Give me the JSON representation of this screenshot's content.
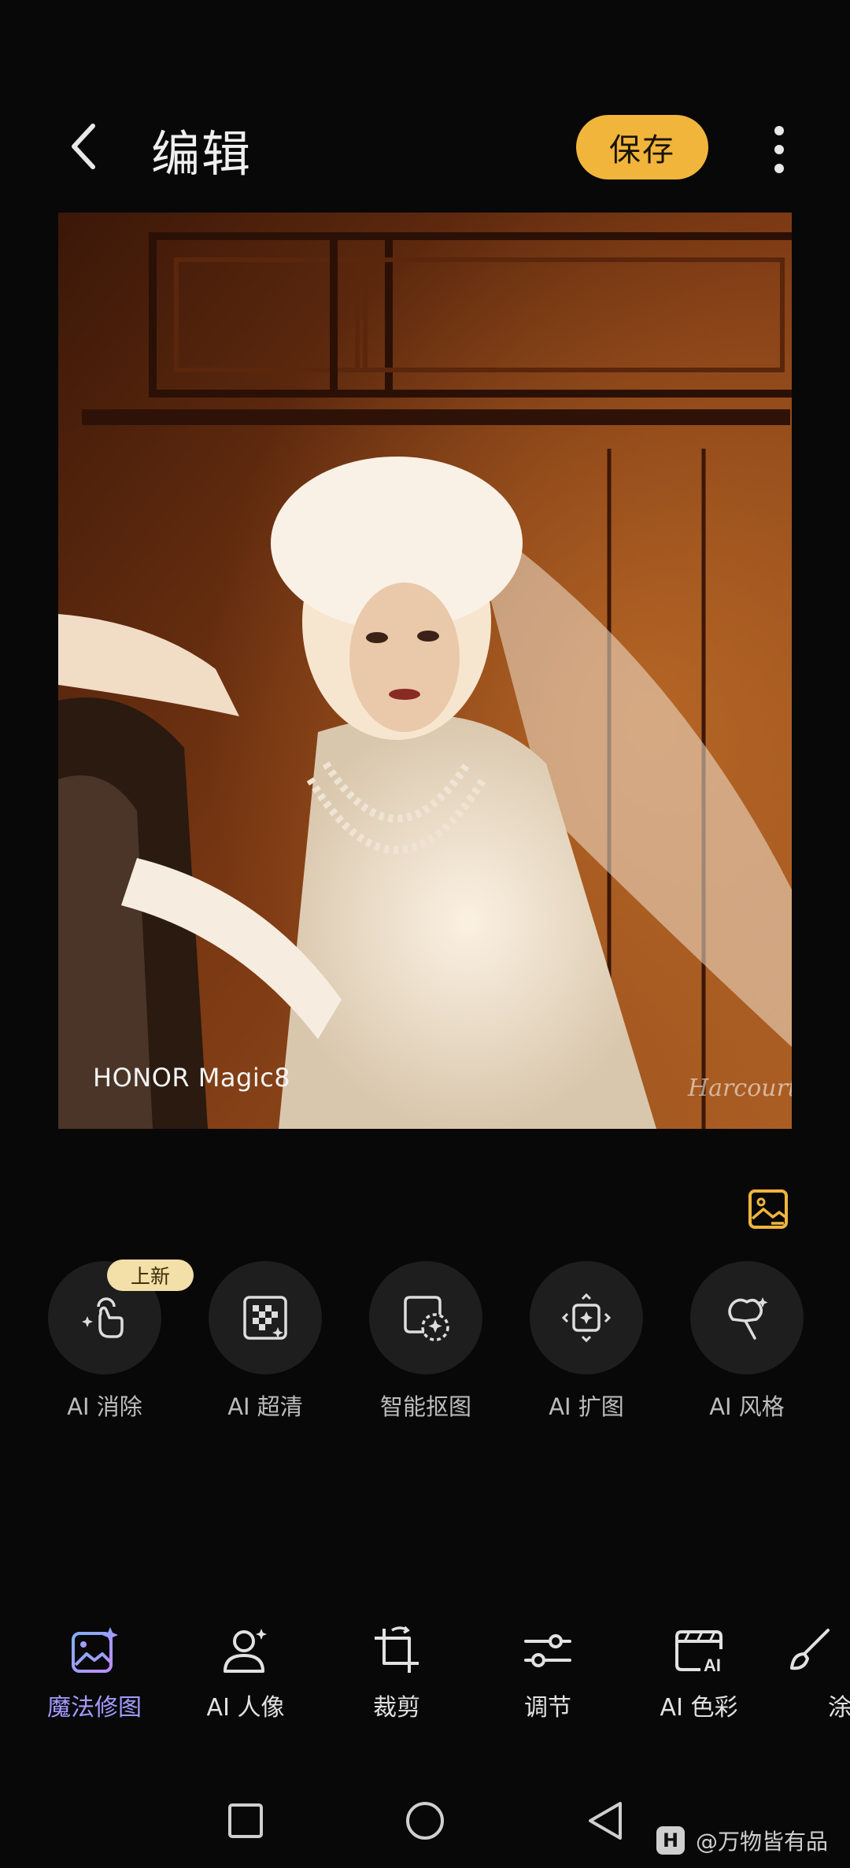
{
  "header": {
    "title": "编辑",
    "save_label": "保存",
    "back_icon": "chevron-left-icon",
    "more_icon": "more-vertical-icon"
  },
  "photo": {
    "watermark": "HONOR Magic8",
    "signature": "Harcourt",
    "description_colors": {
      "wood": "#6a2e12",
      "dress": "#f1e6d6"
    }
  },
  "tools": [
    {
      "label": "AI 消除",
      "icon": "magic-erase-icon",
      "badge": "上新"
    },
    {
      "label": "AI 超清",
      "icon": "ai-hd-icon"
    },
    {
      "label": "智能抠图",
      "icon": "smart-cutout-icon"
    },
    {
      "label": "AI 扩图",
      "icon": "ai-expand-icon"
    },
    {
      "label": "AI 风格",
      "icon": "ai-style-icon"
    }
  ],
  "tabs": [
    {
      "label": "魔法修图",
      "icon": "magic-edit-icon",
      "active": true
    },
    {
      "label": "AI 人像",
      "icon": "ai-portrait-icon"
    },
    {
      "label": "裁剪",
      "icon": "crop-icon"
    },
    {
      "label": "调节",
      "icon": "adjust-icon"
    },
    {
      "label": "AI 色彩",
      "icon": "ai-color-icon"
    },
    {
      "label": "涂",
      "icon": "brush-icon"
    }
  ],
  "credit": {
    "logo": "H",
    "text": "@万物皆有品"
  },
  "colors": {
    "accent": "#f1b53c",
    "active_tab": "#a49bff",
    "background": "#080808"
  }
}
